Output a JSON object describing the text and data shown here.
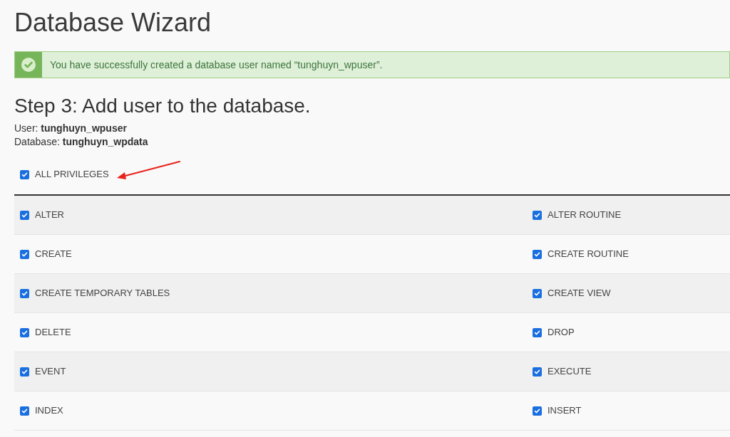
{
  "page": {
    "title": "Database Wizard"
  },
  "alert": {
    "kind": "success",
    "message": "You have successfully created a database user named “tunghuyn_wpuser”."
  },
  "step": {
    "heading": "Step 3: Add user to the database.",
    "details": [
      "User: **tunghuyn_wpuser**",
      "Database: **tunghuyn_wpdata**"
    ]
  },
  "all_privileges": {
    "label": "ALL PRIVILEGES",
    "checked": true
  },
  "privilege_rows": [
    {
      "cells": [
        {
          "label": "ALTER",
          "checked": true
        },
        {
          "label": "ALTER ROUTINE",
          "checked": true
        }
      ]
    },
    {
      "cells": [
        {
          "label": "CREATE",
          "checked": true
        },
        {
          "label": "CREATE ROUTINE",
          "checked": true
        }
      ]
    },
    {
      "cells": [
        {
          "label": "CREATE TEMPORARY TABLES",
          "checked": true
        },
        {
          "label": "CREATE VIEW",
          "checked": true
        }
      ]
    },
    {
      "cells": [
        {
          "label": "DELETE",
          "checked": true
        },
        {
          "label": "DROP",
          "checked": true
        }
      ]
    },
    {
      "cells": [
        {
          "label": "EVENT",
          "checked": true
        },
        {
          "label": "EXECUTE",
          "checked": true
        }
      ]
    },
    {
      "cells": [
        {
          "label": "INDEX",
          "checked": true
        },
        {
          "label": "INSERT",
          "checked": true
        }
      ]
    }
  ]
}
